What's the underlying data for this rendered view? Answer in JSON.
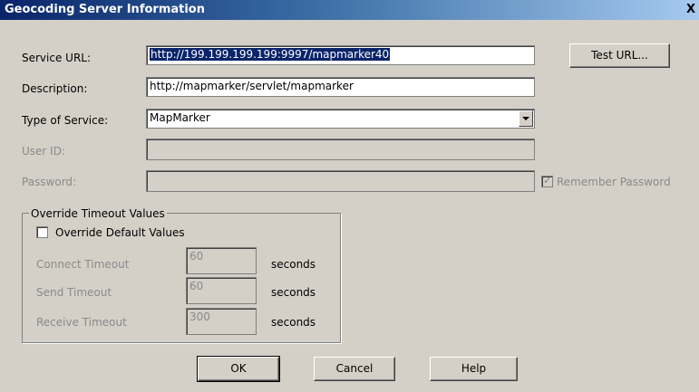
{
  "window": {
    "title": "Geocoding Server Information",
    "close_glyph": "X"
  },
  "form": {
    "service_url": {
      "label": "Service URL:",
      "value": "http://199.199.199.199:9997/mapmarker40"
    },
    "description": {
      "label": "Description:",
      "value": "http://mapmarker/servlet/mapmarker"
    },
    "type_of_service": {
      "label": "Type of Service:",
      "value": "MapMarker"
    },
    "user_id": {
      "label": "User ID:",
      "value": ""
    },
    "password": {
      "label": "Password:",
      "value": ""
    },
    "remember_password": {
      "label": "Remember Password",
      "checked": true,
      "enabled": false
    }
  },
  "buttons": {
    "test_url": "Test URL...",
    "ok": "OK",
    "cancel": "Cancel",
    "help": "Help"
  },
  "timeouts": {
    "group_label": "Override Timeout Values",
    "override_default": {
      "label": "Override Default Values",
      "checked": false
    },
    "connect": {
      "label": "Connect Timeout",
      "value": "60",
      "unit": "seconds"
    },
    "send": {
      "label": "Send Timeout",
      "value": "60",
      "unit": "seconds"
    },
    "receive": {
      "label": "Receive Timeout",
      "value": "300",
      "unit": "seconds"
    }
  }
}
